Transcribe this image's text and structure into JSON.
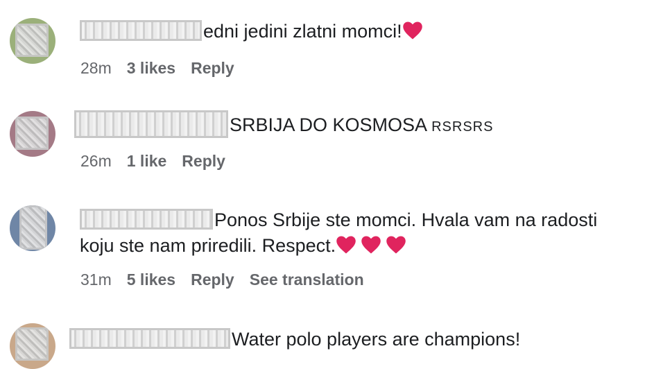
{
  "comments": [
    {
      "author_text_visible": "edni jedini zlatni momci!",
      "hearts": 1,
      "time": "28m",
      "likes": "3 likes",
      "reply": "Reply"
    },
    {
      "author_text_visible": "SRBIJA DO KOSMOSA",
      "tail": "RSRSRS",
      "time": "26m",
      "likes": "1 like",
      "reply": "Reply"
    },
    {
      "line1": "Ponos Srbije ste momci. Hvala vam na radosti",
      "line2": "koju ste nam priredili. Respect.",
      "hearts": 3,
      "time": "31m",
      "likes": "5 likes",
      "reply": "Reply",
      "translate": "See translation"
    },
    {
      "author_text_visible": "Water polo players are champions!"
    }
  ],
  "colors": {
    "text": "#1c1e21",
    "meta": "#65676b",
    "heart": "#e0245e"
  },
  "icons": [
    "heart-icon",
    "avatar-blurred"
  ]
}
